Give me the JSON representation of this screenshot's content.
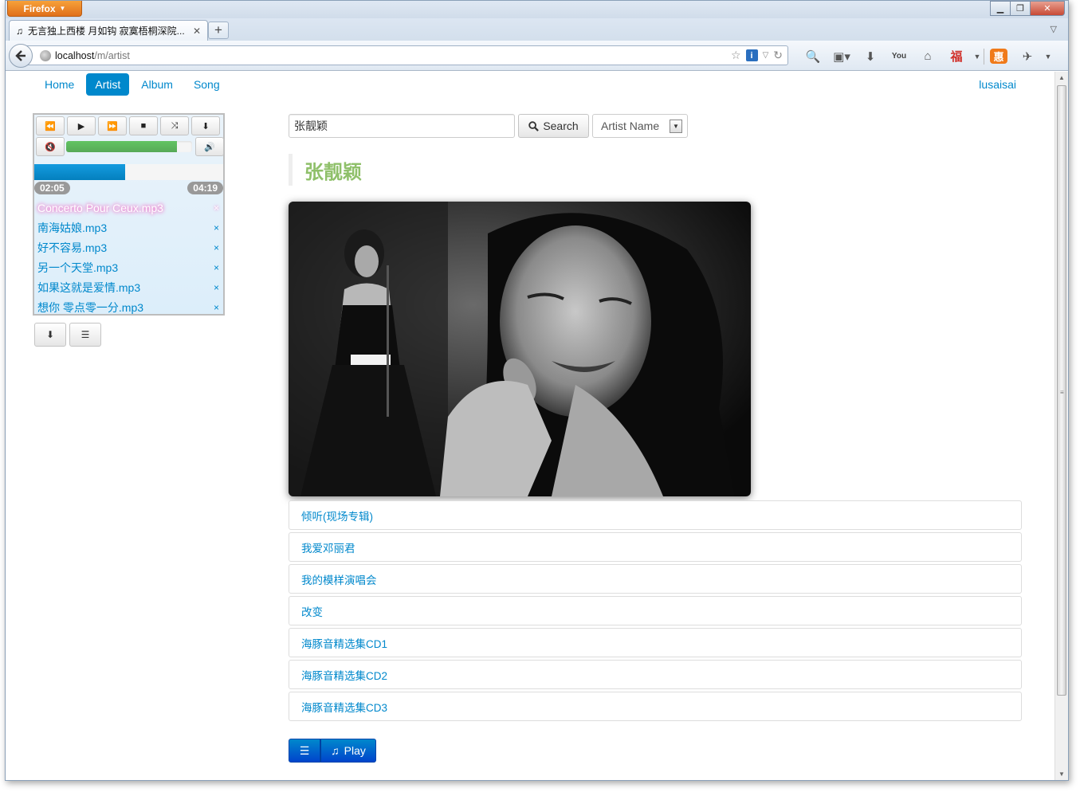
{
  "browser": {
    "app_button": "Firefox",
    "tab_title": "无言独上西楼 月如钩 寂寞梧桐深院...",
    "url_host": "localhost",
    "url_path": "/m/artist"
  },
  "nav": {
    "items": [
      "Home",
      "Artist",
      "Album",
      "Song"
    ],
    "active": "Artist",
    "user": "lusaisai"
  },
  "player": {
    "elapsed": "02:05",
    "duration": "04:19",
    "progress_fraction": 0.48,
    "volume_fraction": 0.88,
    "playlist": [
      {
        "name": "Concerto Pour Ceux.mp3",
        "current": true
      },
      {
        "name": "南海姑娘.mp3",
        "current": false
      },
      {
        "name": "好不容易.mp3",
        "current": false
      },
      {
        "name": "另一个天堂.mp3",
        "current": false
      },
      {
        "name": "如果这就是爱情.mp3",
        "current": false
      },
      {
        "name": "想你 零点零一分.mp3",
        "current": false
      }
    ],
    "remove_glyph": "×"
  },
  "search": {
    "value": "张靓颖",
    "button_label": "Search",
    "type_selected": "Artist Name"
  },
  "artist": {
    "name": "张靓颖",
    "albums": [
      "倾听(现场专辑)",
      "我爱邓丽君",
      "我的模样演唱会",
      "改变",
      "海豚音精选集CD1",
      "海豚音精选集CD2",
      "海豚音精选集CD3"
    ]
  },
  "actions": {
    "play_label": "Play"
  },
  "colors": {
    "accent": "#0088cc",
    "artist_heading": "#8fc06a",
    "progress": "#0480be",
    "volume": "#57a957"
  }
}
